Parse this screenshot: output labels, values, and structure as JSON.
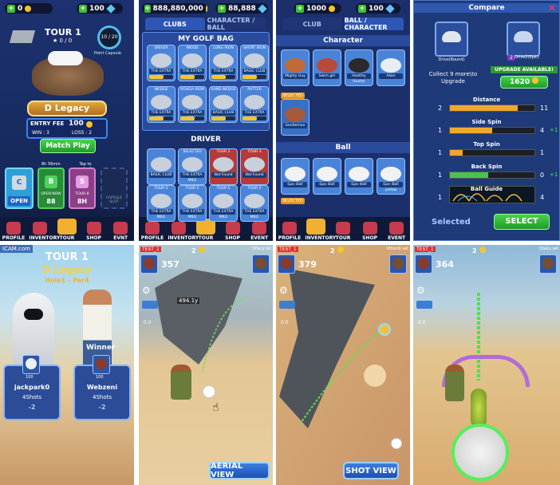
{
  "panel1": {
    "coins": "0",
    "gems": "100",
    "tour_title": "TOUR 1",
    "stars": "★ 0 / 0",
    "capsule_progress": "10 / 20",
    "capsule_label": "Point Capsule",
    "title_badge": "D Legacy",
    "entry_fee_label": "ENTRY FEE",
    "entry_fee": "100",
    "win": "WIN : 3",
    "loss": "LOSS : 2",
    "match_button": "Match Play",
    "timer": "8h 56min",
    "tap_unlock": "Tap to unlock",
    "open_label": "OPEN",
    "open_now": "OPEN NOW",
    "open_now_cost": "88",
    "hours": "8H",
    "slot_label": "CAPSULE SLOT",
    "capsule_letters": [
      "C",
      "B",
      "S"
    ],
    "tour_small": "TOUR 8",
    "nav": [
      "PROFILE",
      "INVENTORY",
      "TOUR",
      "SHOP",
      "EVNT"
    ]
  },
  "panel2": {
    "coins": "888,880,000",
    "gems": "88,888",
    "tab_clubs": "CLUBS",
    "tab_char": "CHARACTER / BALL",
    "bag_title": "MY GOLF BAG",
    "row1": [
      "DRIVER",
      "WOOD",
      "LONG IRON",
      "SHORT IRON"
    ],
    "row2": [
      "WEDGE",
      "ROUGH IRON",
      "SAND WEDGE",
      "PUTTER"
    ],
    "card_label": "THE EXTRA MILE",
    "basic_club": "BASIC CLUB",
    "driver_title": "DRIVER",
    "selected": "SELECTED",
    "tour2": "TOUR 2",
    "tour3": "TOUR 3",
    "tour5": "TOUR 5",
    "not_found": "Not Found",
    "nav": [
      "PROFILE",
      "INVENTORY",
      "TOUR",
      "SHOP",
      "EVENT"
    ]
  },
  "panel3": {
    "coins": "1000",
    "gems": "100",
    "tab_club": "CLUB",
    "tab_ball": "BALL / CHARACTER",
    "character_title": "Character",
    "chars": [
      "Mighty Guy",
      "Swim girl",
      "Healthy Hunter",
      "Alien"
    ],
    "selected": "SELECTED",
    "selected_name": "Gentleman",
    "ball_title": "Ball",
    "balls": [
      "Epic Ball",
      "Epic Ball",
      "Epic Ball",
      "Epic Ball yellow"
    ],
    "nav": [
      "PROFILE",
      "INVENTORY",
      "TOUR",
      "SHOP",
      "EVENT"
    ]
  },
  "panel4": {
    "title": "Compare",
    "club_left": "Drive(Round)",
    "club_right": "Drive2(Epic)",
    "level_right": "2",
    "collect_text": "Collect 9 more\\to Upgrade",
    "upgrade_available": "UPGRADE AVAILABLE!",
    "upgrade_cost": "1620",
    "stats": [
      {
        "name": "Distance",
        "left": "2",
        "right": "11",
        "delta": ""
      },
      {
        "name": "Side Spin",
        "left": "1",
        "right": "4",
        "delta": "+1"
      },
      {
        "name": "Top Spin",
        "left": "1",
        "right": "1",
        "delta": ""
      },
      {
        "name": "Back Spin",
        "left": "1",
        "right": "0",
        "delta": "+1"
      },
      {
        "name": "Ball Guide",
        "left": "1",
        "right": "4",
        "delta": ""
      }
    ],
    "stat_fill": [
      0.8,
      0.5,
      0.15,
      0.45
    ],
    "selected_label": "Selected",
    "select_button": "SELECT"
  },
  "panel5": {
    "header_left": "ICAM.com",
    "tour": "TOUR 1",
    "course": "D Legacy",
    "hole": "Hole1 - Par4",
    "winner": "Winner",
    "player1": {
      "name": "jackpark0",
      "shots": "4Shots",
      "score": "-2"
    },
    "player2": {
      "name": "Webzeni",
      "shots": "4Shots",
      "score": "-2"
    },
    "level": "100"
  },
  "panel6": {
    "player": "TEST_1",
    "score": "357",
    "stroke": "2",
    "opponent": "Ofiacy Jet",
    "distance": "494.1y",
    "wind": "0.0",
    "level": "100",
    "view_button": "AERIAL VIEW"
  },
  "panel7": {
    "player": "TEST_1",
    "score": "379",
    "stroke": "2",
    "opponent": "Otherdi set",
    "wind": "0.0",
    "level": "100",
    "view_button": "SHOT VIEW"
  },
  "panel8": {
    "player": "TEST_1",
    "score": "364",
    "stroke": "2",
    "opponent": "Otaku set",
    "wind": "0.0",
    "level": "100"
  }
}
